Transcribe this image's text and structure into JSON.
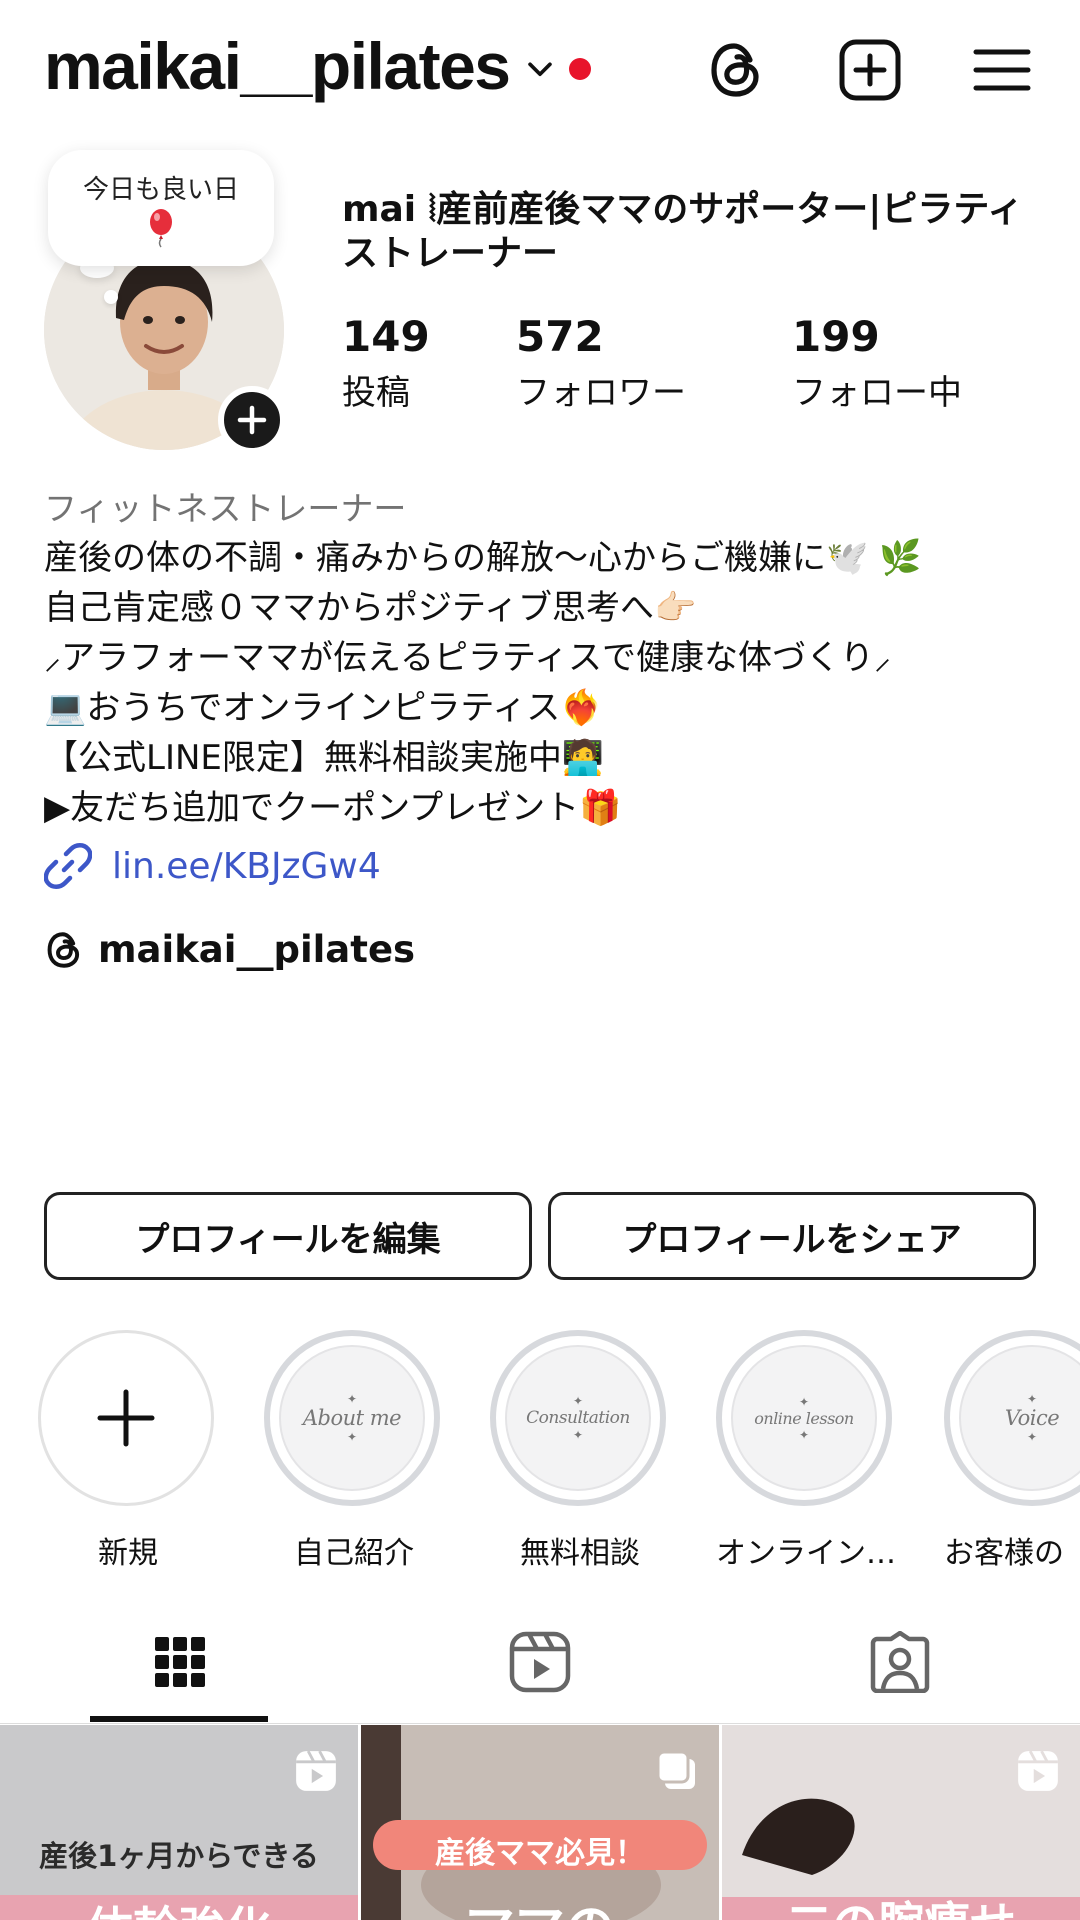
{
  "topbar": {
    "username": "maikai__pilates",
    "icons": [
      "chevron-down-icon",
      "notification-dot",
      "threads-icon",
      "new-post-icon",
      "menu-icon"
    ]
  },
  "note": {
    "text": "今日も良い日",
    "emoji": "🎈"
  },
  "profile": {
    "display_name_line1": "mai ⦚産前産後ママのサポーター|ピラティ",
    "display_name_line2": "ストレーナー",
    "stats": [
      {
        "value": "149",
        "label": "投稿"
      },
      {
        "value": "572",
        "label": "フォロワー"
      },
      {
        "value": "199",
        "label": "フォロー中"
      }
    ]
  },
  "bio": {
    "category": "フィットネストレーナー",
    "lines": [
      "産後の体の不調・痛みからの解放〜心からご機嫌に🕊️ 🌿",
      "自己肯定感０ママからポジティブ思考へ👉🏻",
      "︎⸝アラフォーママが伝えるピラティスで健康な体づくり⸝",
      "💻おうちでオンラインピラティス❤️‍🔥",
      "【公式LINE限定】無料相談実施中🧑‍💻",
      "▶︎友だち追加でクーポンプレゼント🎁"
    ],
    "link": "lin.ee/KBJzGw4",
    "threads_handle": "maikai__pilates"
  },
  "buttons": {
    "edit": "プロフィールを編集",
    "share": "プロフィールをシェア"
  },
  "highlights": [
    {
      "label": "新規",
      "cover": ""
    },
    {
      "label": "自己紹介",
      "cover": "About me"
    },
    {
      "label": "無料相談",
      "cover": "Consultation"
    },
    {
      "label": "オンライン…",
      "cover": "online lesson"
    },
    {
      "label": "お客様の",
      "cover": "Voice"
    }
  ],
  "tabs": [
    "grid-icon",
    "reels-icon",
    "tagged-icon"
  ],
  "posts": [
    {
      "caption_top": "産後1ヶ月からできる",
      "caption_bottom": "体幹強化",
      "badge": "reels-icon"
    },
    {
      "caption_top": "産後ママ必見！",
      "caption_bottom": "ママの",
      "badge": "carousel-icon"
    },
    {
      "caption_top": "",
      "caption_bottom": "二の腕痩せ",
      "badge": "reels-icon"
    }
  ],
  "colors": {
    "link": "#3d57c8",
    "notification_dot": "#e8142b",
    "category_gray": "#737373",
    "post_pink": "#e8a3b0",
    "post_salmon": "#f1867a"
  }
}
